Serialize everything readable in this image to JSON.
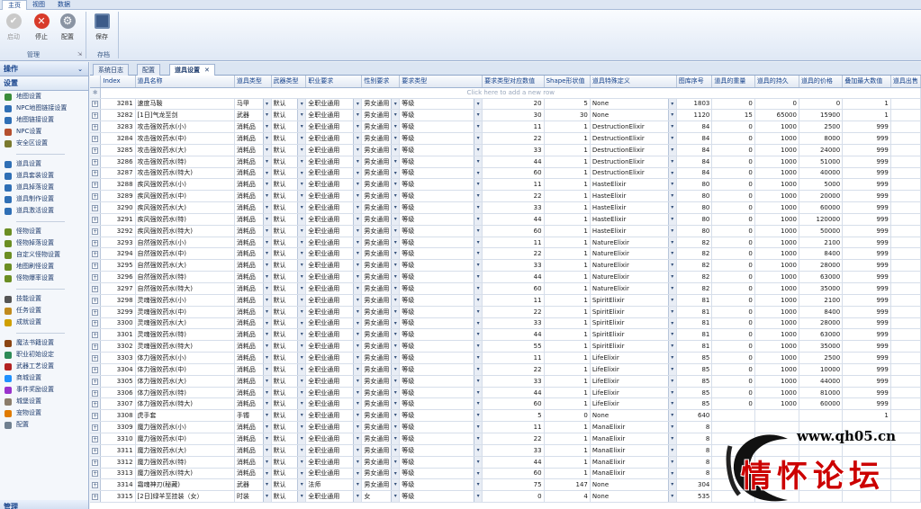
{
  "ribbon": {
    "tabs": [
      "主页",
      "视图",
      "数据"
    ],
    "buttons": {
      "start": "启动",
      "stop": "停止",
      "config": "配置",
      "save": "保存"
    },
    "groups": {
      "manage": "管理",
      "archive": "存档"
    }
  },
  "nav": {
    "ops_header": "操作",
    "settings_header": "设置",
    "bottom_header": "管理",
    "items": [
      {
        "label": "地图设置",
        "icon": "map-icon"
      },
      {
        "label": "NPC地图链接设置",
        "icon": "link-icon"
      },
      {
        "label": "地图链接设置",
        "icon": "link-icon"
      },
      {
        "label": "NPC设置",
        "icon": "person-icon"
      },
      {
        "label": "安全区设置",
        "icon": "shield-icon"
      },
      {
        "sep": true
      },
      {
        "label": "道具设置",
        "icon": "box-icon"
      },
      {
        "label": "道具套装设置",
        "icon": "box-icon"
      },
      {
        "label": "道具掉落设置",
        "icon": "box-icon"
      },
      {
        "label": "道具制作设置",
        "icon": "box-icon"
      },
      {
        "label": "道具激活设置",
        "icon": "box-icon"
      },
      {
        "sep": true
      },
      {
        "label": "怪物设置",
        "icon": "monster-icon"
      },
      {
        "label": "怪物掉落设置",
        "icon": "monster-icon"
      },
      {
        "label": "自定义怪物设置",
        "icon": "monster-icon"
      },
      {
        "label": "地图刷怪设置",
        "icon": "monster-icon"
      },
      {
        "label": "怪物爆率设置",
        "icon": "monster-icon"
      },
      {
        "sep": true
      },
      {
        "label": "技能设置",
        "icon": "skill-icon"
      },
      {
        "label": "任务设置",
        "icon": "quest-icon"
      },
      {
        "label": "成就设置",
        "icon": "trophy-icon"
      },
      {
        "sep": true
      },
      {
        "label": "魔法书籍设置",
        "icon": "book-icon"
      },
      {
        "label": "职业初始设定",
        "icon": "class-icon"
      },
      {
        "label": "武器工艺设置",
        "icon": "weapon-icon"
      },
      {
        "label": "商城设置",
        "icon": "shop-icon"
      },
      {
        "label": "事件奖励设置",
        "icon": "event-icon"
      },
      {
        "label": "城堡设置",
        "icon": "castle-icon"
      },
      {
        "label": "宠物设置",
        "icon": "pet-icon"
      },
      {
        "label": "配置",
        "icon": "gear-icon"
      }
    ]
  },
  "doc_tabs": [
    "系统日志",
    "配置",
    "道具设置"
  ],
  "grid": {
    "columns": [
      "Index",
      "道具名称",
      "道具类型",
      "武器类型",
      "职业要求",
      "性别要求",
      "要求类型",
      "要求类型对应数值",
      "Shape形状值",
      "道具特殊定义",
      "图库序号",
      "道具的重量",
      "道具的持久",
      "道具的价格",
      "叠加最大数值",
      "道具出售"
    ],
    "new_row_hint": "Click here to add a new row",
    "rows": [
      [
        "3281",
        "速度马鞍",
        "马甲",
        "默认",
        "全职业通用",
        "男女通用",
        "等级",
        "20",
        "5",
        "None",
        "1803",
        "0",
        "0",
        "0",
        "1"
      ],
      [
        "3282",
        "[1日]气龙至剑",
        "武器",
        "默认",
        "全职业通用",
        "男女通用",
        "等级",
        "30",
        "30",
        "None",
        "1120",
        "15",
        "65000",
        "15900",
        "1"
      ],
      [
        "3283",
        "攻击强效药水(小)",
        "消耗品",
        "默认",
        "全职业通用",
        "男女通用",
        "等级",
        "11",
        "1",
        "DestructionElixir",
        "84",
        "0",
        "1000",
        "2500",
        "999"
      ],
      [
        "3284",
        "攻击强效药水(中)",
        "消耗品",
        "默认",
        "全职业通用",
        "男女通用",
        "等级",
        "22",
        "1",
        "DestructionElixir",
        "84",
        "0",
        "1000",
        "8000",
        "999"
      ],
      [
        "3285",
        "攻击强效药水(大)",
        "消耗品",
        "默认",
        "全职业通用",
        "男女通用",
        "等级",
        "33",
        "1",
        "DestructionElixir",
        "84",
        "0",
        "1000",
        "24000",
        "999"
      ],
      [
        "3286",
        "攻击强效药水(特)",
        "消耗品",
        "默认",
        "全职业通用",
        "男女通用",
        "等级",
        "44",
        "1",
        "DestructionElixir",
        "84",
        "0",
        "1000",
        "51000",
        "999"
      ],
      [
        "3287",
        "攻击强效药水(特大)",
        "消耗品",
        "默认",
        "全职业通用",
        "男女通用",
        "等级",
        "60",
        "1",
        "DestructionElixir",
        "84",
        "0",
        "1000",
        "40000",
        "999"
      ],
      [
        "3288",
        "疾风强效药水(小)",
        "消耗品",
        "默认",
        "全职业通用",
        "男女通用",
        "等级",
        "11",
        "1",
        "HasteElixir",
        "80",
        "0",
        "1000",
        "5000",
        "999"
      ],
      [
        "3289",
        "疾风强效药水(中)",
        "消耗品",
        "默认",
        "全职业通用",
        "男女通用",
        "等级",
        "22",
        "1",
        "HasteElixir",
        "80",
        "0",
        "1000",
        "20000",
        "999"
      ],
      [
        "3290",
        "疾风强效药水(大)",
        "消耗品",
        "默认",
        "全职业通用",
        "男女通用",
        "等级",
        "33",
        "1",
        "HasteElixir",
        "80",
        "0",
        "1000",
        "60000",
        "999"
      ],
      [
        "3291",
        "疾风强效药水(特)",
        "消耗品",
        "默认",
        "全职业通用",
        "男女通用",
        "等级",
        "44",
        "1",
        "HasteElixir",
        "80",
        "0",
        "1000",
        "120000",
        "999"
      ],
      [
        "3292",
        "疾风强效药水(特大)",
        "消耗品",
        "默认",
        "全职业通用",
        "男女通用",
        "等级",
        "60",
        "1",
        "HasteElixir",
        "80",
        "0",
        "1000",
        "50000",
        "999"
      ],
      [
        "3293",
        "自然强效药水(小)",
        "消耗品",
        "默认",
        "全职业通用",
        "男女通用",
        "等级",
        "11",
        "1",
        "NatureElixir",
        "82",
        "0",
        "1000",
        "2100",
        "999"
      ],
      [
        "3294",
        "自然强效药水(中)",
        "消耗品",
        "默认",
        "全职业通用",
        "男女通用",
        "等级",
        "22",
        "1",
        "NatureElixir",
        "82",
        "0",
        "1000",
        "8400",
        "999"
      ],
      [
        "3295",
        "自然强效药水(大)",
        "消耗品",
        "默认",
        "全职业通用",
        "男女通用",
        "等级",
        "33",
        "1",
        "NatureElixir",
        "82",
        "0",
        "1000",
        "28000",
        "999"
      ],
      [
        "3296",
        "自然强效药水(特)",
        "消耗品",
        "默认",
        "全职业通用",
        "男女通用",
        "等级",
        "44",
        "1",
        "NatureElixir",
        "82",
        "0",
        "1000",
        "63000",
        "999"
      ],
      [
        "3297",
        "自然强效药水(特大)",
        "消耗品",
        "默认",
        "全职业通用",
        "男女通用",
        "等级",
        "60",
        "1",
        "NatureElixir",
        "82",
        "0",
        "1000",
        "35000",
        "999"
      ],
      [
        "3298",
        "灵魂强效药水(小)",
        "消耗品",
        "默认",
        "全职业通用",
        "男女通用",
        "等级",
        "11",
        "1",
        "SpiritElixir",
        "81",
        "0",
        "1000",
        "2100",
        "999"
      ],
      [
        "3299",
        "灵魂强效药水(中)",
        "消耗品",
        "默认",
        "全职业通用",
        "男女通用",
        "等级",
        "22",
        "1",
        "SpiritElixir",
        "81",
        "0",
        "1000",
        "8400",
        "999"
      ],
      [
        "3300",
        "灵魂强效药水(大)",
        "消耗品",
        "默认",
        "全职业通用",
        "男女通用",
        "等级",
        "33",
        "1",
        "SpiritElixir",
        "81",
        "0",
        "1000",
        "28000",
        "999"
      ],
      [
        "3301",
        "灵魂强效药水(特)",
        "消耗品",
        "默认",
        "全职业通用",
        "男女通用",
        "等级",
        "44",
        "1",
        "SpiritElixir",
        "81",
        "0",
        "1000",
        "63000",
        "999"
      ],
      [
        "3302",
        "灵魂强效药水(特大)",
        "消耗品",
        "默认",
        "全职业通用",
        "男女通用",
        "等级",
        "55",
        "1",
        "SpiritElixir",
        "81",
        "0",
        "1000",
        "35000",
        "999"
      ],
      [
        "3303",
        "体力强效药水(小)",
        "消耗品",
        "默认",
        "全职业通用",
        "男女通用",
        "等级",
        "11",
        "1",
        "LifeElixir",
        "85",
        "0",
        "1000",
        "2500",
        "999"
      ],
      [
        "3304",
        "体力强效药水(中)",
        "消耗品",
        "默认",
        "全职业通用",
        "男女通用",
        "等级",
        "22",
        "1",
        "LifeElixir",
        "85",
        "0",
        "1000",
        "10000",
        "999"
      ],
      [
        "3305",
        "体力强效药水(大)",
        "消耗品",
        "默认",
        "全职业通用",
        "男女通用",
        "等级",
        "33",
        "1",
        "LifeElixir",
        "85",
        "0",
        "1000",
        "44000",
        "999"
      ],
      [
        "3306",
        "体力强效药水(特)",
        "消耗品",
        "默认",
        "全职业通用",
        "男女通用",
        "等级",
        "44",
        "1",
        "LifeElixir",
        "85",
        "0",
        "1000",
        "81000",
        "999"
      ],
      [
        "3307",
        "体力强效药水(特大)",
        "消耗品",
        "默认",
        "全职业通用",
        "男女通用",
        "等级",
        "60",
        "1",
        "LifeElixir",
        "85",
        "0",
        "1000",
        "60000",
        "999"
      ],
      [
        "3308",
        "虎手套",
        "手镯",
        "默认",
        "全职业通用",
        "男女通用",
        "等级",
        "5",
        "0",
        "None",
        "640",
        "",
        "",
        "",
        "1"
      ],
      [
        "3309",
        "魔力强效药水(小)",
        "消耗品",
        "默认",
        "全职业通用",
        "男女通用",
        "等级",
        "11",
        "1",
        "ManaElixir",
        "8",
        "",
        "",
        "",
        ""
      ],
      [
        "3310",
        "魔力强效药水(中)",
        "消耗品",
        "默认",
        "全职业通用",
        "男女通用",
        "等级",
        "22",
        "1",
        "ManaElixir",
        "8",
        "",
        "",
        "",
        ""
      ],
      [
        "3311",
        "魔力强效药水(大)",
        "消耗品",
        "默认",
        "全职业通用",
        "男女通用",
        "等级",
        "33",
        "1",
        "ManaElixir",
        "8",
        "",
        "",
        "",
        ""
      ],
      [
        "3312",
        "魔力强效药水(特)",
        "消耗品",
        "默认",
        "全职业通用",
        "男女通用",
        "等级",
        "44",
        "1",
        "ManaElixir",
        "8",
        "",
        "",
        "",
        ""
      ],
      [
        "3313",
        "魔力强效药水(特大)",
        "消耗品",
        "默认",
        "全职业通用",
        "男女通用",
        "等级",
        "60",
        "1",
        "ManaElixir",
        "8",
        "",
        "",
        "",
        ""
      ],
      [
        "3314",
        "霜魂神刃(秘藏)",
        "武器",
        "默认",
        "法师",
        "男女通用",
        "等级",
        "75",
        "147",
        "None",
        "304",
        "",
        "",
        "",
        ""
      ],
      [
        "3315",
        "[2日]绿羊至挂装（女）",
        "时装",
        "默认",
        "全职业通用",
        "女",
        "等级",
        "0",
        "4",
        "None",
        "535",
        "",
        "",
        "",
        ""
      ]
    ]
  },
  "watermark": {
    "url": "www.qh05.cn",
    "brand": "情怀论坛"
  }
}
